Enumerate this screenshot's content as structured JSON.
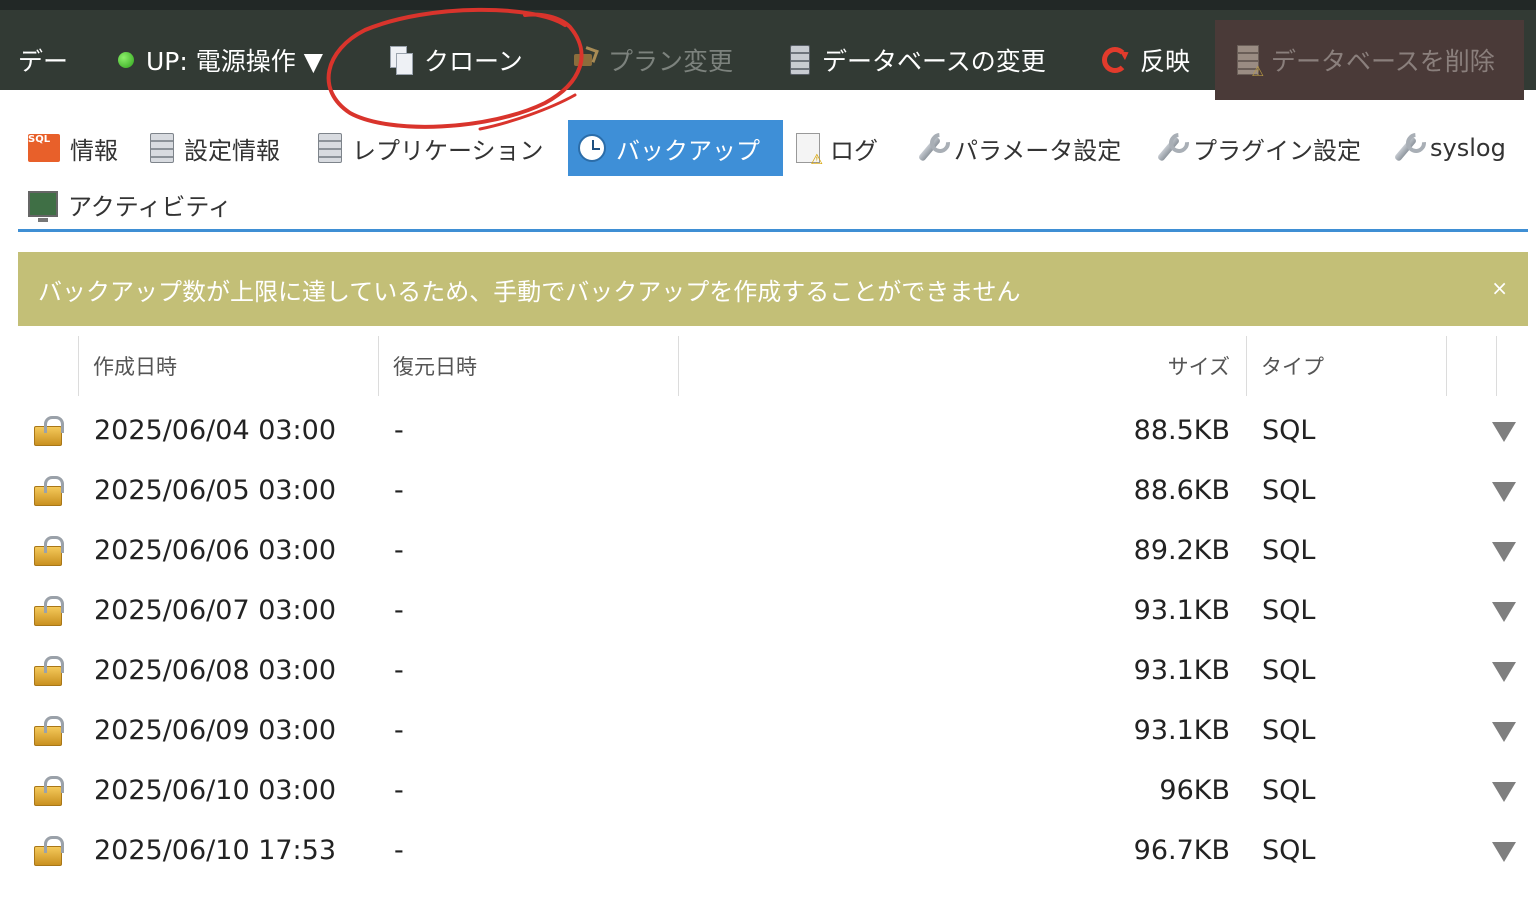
{
  "topbar": {
    "truncated": "デー",
    "status_label": "UP: 電源操作 ▼",
    "clone": "クローン",
    "plan_change": "プラン変更",
    "db_change": "データベースの変更",
    "apply": "反映",
    "delete_db": "データベースを削除"
  },
  "tabs": {
    "info": "情報",
    "settings": "設定情報",
    "replication": "レプリケーション",
    "backup": "バックアップ",
    "log": "ログ",
    "params": "パラメータ設定",
    "plugins": "プラグイン設定",
    "syslog": "syslog",
    "activity": "アクティビティ"
  },
  "alert": {
    "message": "バックアップ数が上限に達しているため、手動でバックアップを作成することができません",
    "close": "×"
  },
  "table": {
    "headers": {
      "created": "作成日時",
      "restored": "復元日時",
      "size": "サイズ",
      "type": "タイプ"
    },
    "rows": [
      {
        "created": "2025/06/04 03:00",
        "restored": "-",
        "size": "88.5KB",
        "type": "SQL"
      },
      {
        "created": "2025/06/05 03:00",
        "restored": "-",
        "size": "88.6KB",
        "type": "SQL"
      },
      {
        "created": "2025/06/06 03:00",
        "restored": "-",
        "size": "89.2KB",
        "type": "SQL"
      },
      {
        "created": "2025/06/07 03:00",
        "restored": "-",
        "size": "93.1KB",
        "type": "SQL"
      },
      {
        "created": "2025/06/08 03:00",
        "restored": "-",
        "size": "93.1KB",
        "type": "SQL"
      },
      {
        "created": "2025/06/09 03:00",
        "restored": "-",
        "size": "93.1KB",
        "type": "SQL"
      },
      {
        "created": "2025/06/10 03:00",
        "restored": "-",
        "size": "96KB",
        "type": "SQL"
      },
      {
        "created": "2025/06/10 17:53",
        "restored": "-",
        "size": "96.7KB",
        "type": "SQL"
      }
    ]
  },
  "colors": {
    "topbar": "#323a34",
    "active_tab": "#3e8fd7",
    "alert": "#c3bf77",
    "annotation": "#d9342c"
  },
  "icons": {
    "status": "green-dot-icon",
    "clone": "copy-icon",
    "plan": "plan-change-icon",
    "database": "database-icon",
    "apply": "refresh-icon",
    "delete": "database-delete-icon",
    "backup": "clock-icon",
    "log": "log-warning-icon",
    "settings": "wrench-icon",
    "activity": "monitor-icon",
    "row": "unlocked-padlock-icon",
    "row_menu": "triangle-down-icon"
  }
}
